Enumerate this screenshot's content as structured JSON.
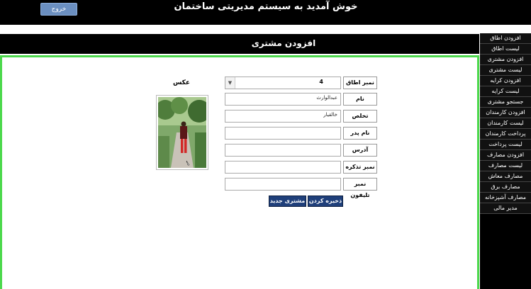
{
  "header": {
    "welcome": "خوش آمدید به سیستم مدیریتی ساختمان",
    "logout_label": "خروج"
  },
  "page": {
    "title": "افزودن مشتری"
  },
  "sidebar": {
    "items": [
      "افزودن اطاق",
      "لیست اطاق",
      "افزودن مشتری",
      "لیست مشتری",
      "افزودن کرایه",
      "لیست کرایه",
      "جستجو مشتری",
      "افزودن کارمندان",
      "لیست کارمندان",
      "پرداخت کارمندان",
      "لیست پرداخت",
      "افزودن مصارف",
      "لیست مصارف",
      "مصارف معاش",
      "مصارف برق",
      "مصارف آشپزخانه",
      "مدیر مالی"
    ]
  },
  "form": {
    "room_number": {
      "label": "نمبر اطاق",
      "value": "4"
    },
    "name": {
      "label": "نام",
      "value": "عبدالوارث"
    },
    "surname": {
      "label": "تخلص",
      "value": "خالقیار"
    },
    "father_name": {
      "label": "نام پدر",
      "value": ""
    },
    "address": {
      "label": "آدرس",
      "value": ""
    },
    "id_number": {
      "label": "نمبر تذکره",
      "value": ""
    },
    "phone": {
      "label": "نمبر تلیفون",
      "value": ""
    },
    "photo_label": "عکس",
    "save_label": "ذخیره کردن",
    "new_label": "مشتری جدید"
  }
}
